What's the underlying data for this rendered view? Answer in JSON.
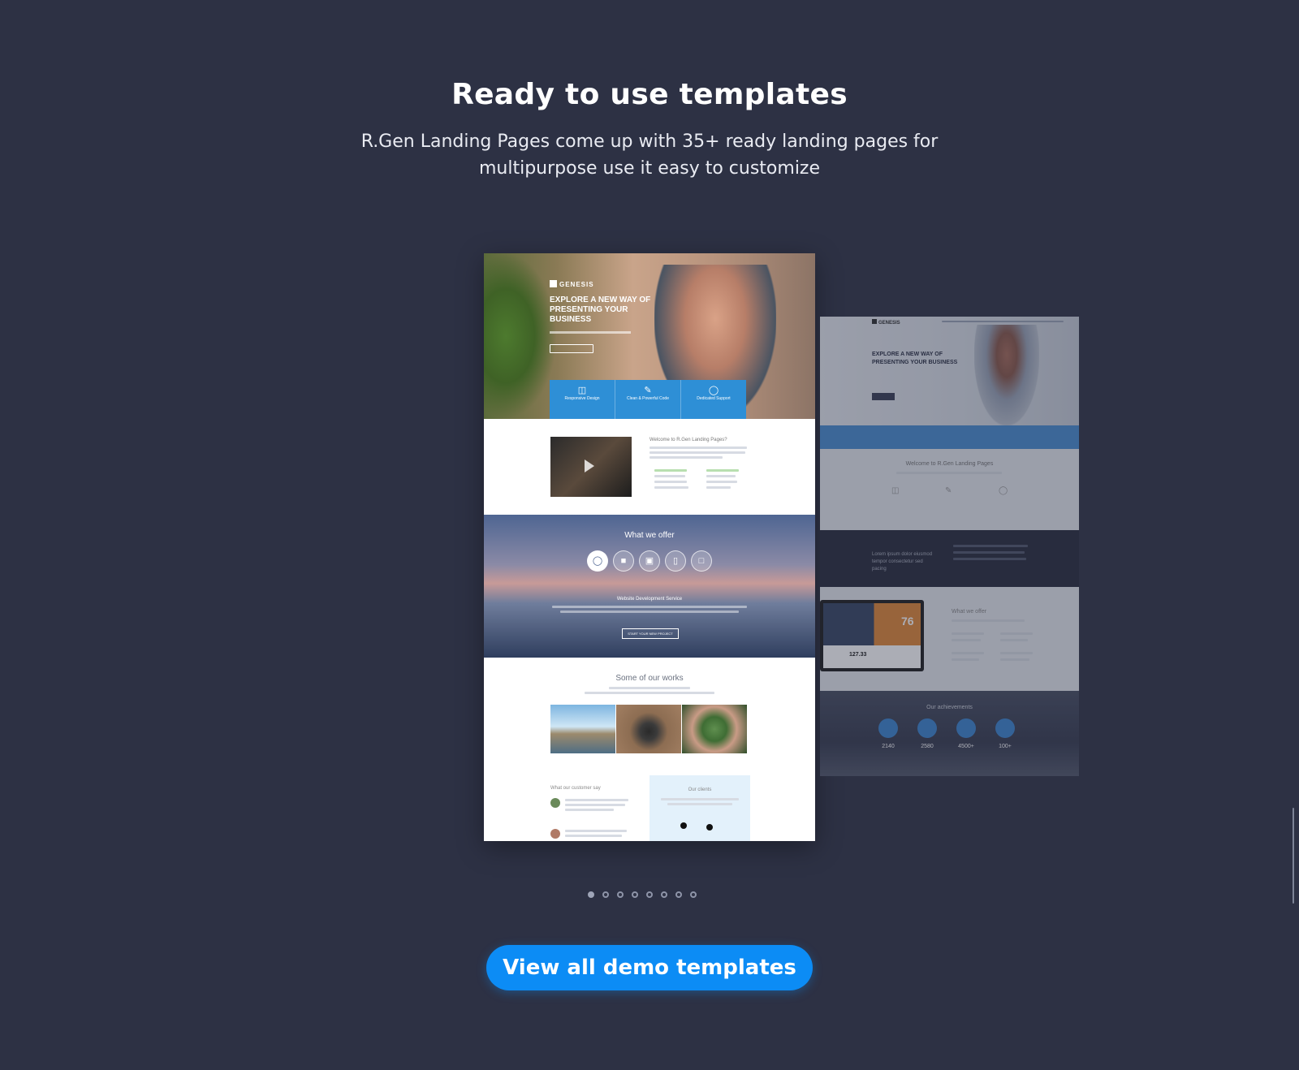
{
  "section": {
    "title": "Ready to use templates",
    "subtitle": "R.Gen Landing Pages come up with 35+ ready landing pages for multipurpose use it easy to customize"
  },
  "main_preview": {
    "brand": "GENESIS",
    "hero_headline": "EXPLORE A NEW WAY OF PRESENTING YOUR BUSINESS",
    "feature_labels": [
      "Responsive Design",
      "Clean & Powerful Code",
      "Dedicated Support"
    ],
    "welcome_heading": "Welcome to R.Gen Landing Pages?",
    "offer_heading": "What we offer",
    "offer_subheading": "Website Development Service",
    "offer_button": "START YOUR NEW PROJECT",
    "works_heading": "Some of our works",
    "testimonials_heading": "What our customer say",
    "clients_heading": "Our clients"
  },
  "side_preview": {
    "brand": "GENESIS",
    "hero_headline": "EXPLORE A NEW WAY OF PRESENTING YOUR BUSINESS",
    "welcome_heading": "Welcome to R.Gen Landing Pages",
    "dark_band_text": "Lorem ipsum dolor eiusmod tempor consectetur sed pacing",
    "laptop_big_number": "76",
    "laptop_small_number": "127.33",
    "offer_heading": "What we offer",
    "achievements_heading": "Our achievements",
    "stats": [
      "2140",
      "2580",
      "4500+",
      "100+"
    ]
  },
  "pagination": {
    "count": 8,
    "active_index": 0
  },
  "cta": {
    "label": "View all demo templates"
  },
  "colors": {
    "background": "#2d3144",
    "accent": "#0c8cf5"
  }
}
